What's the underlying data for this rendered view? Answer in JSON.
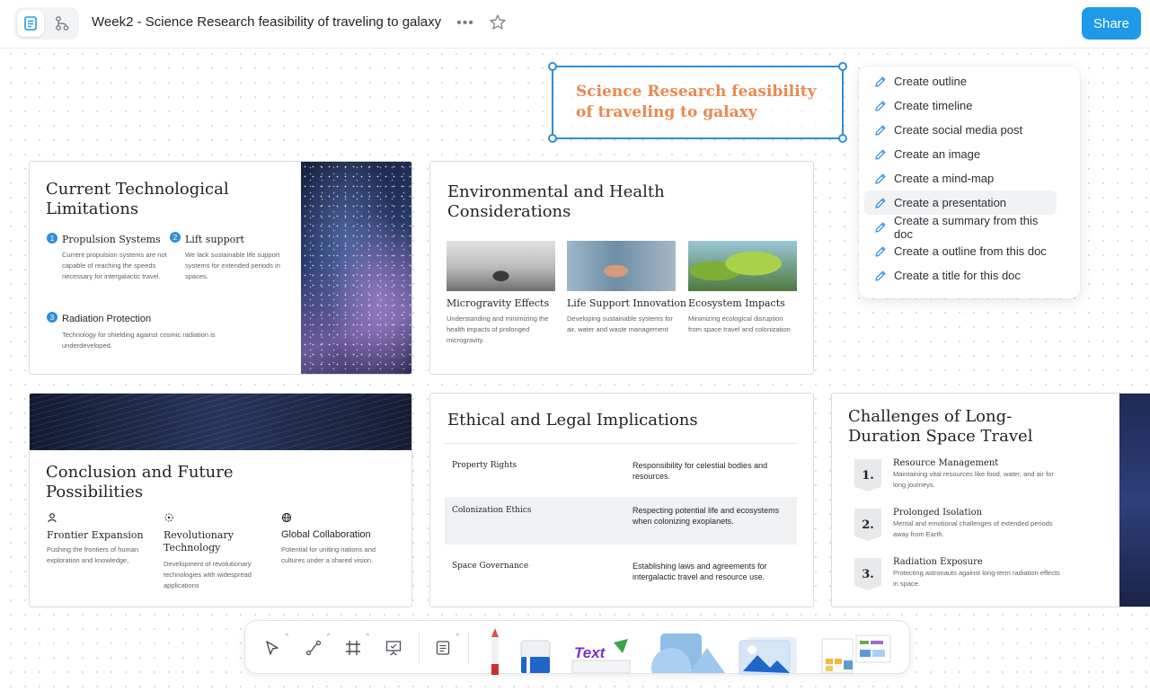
{
  "header": {
    "doc_title": "Week2 -  Science Research feasibility of traveling to galaxy",
    "share_label": "Share",
    "more_label": "•••"
  },
  "selected_text": "Science Research feasibility of traveling to galaxy",
  "ai_menu": {
    "items": [
      "Create outline",
      "Create timeline",
      "Create social media post",
      "Create an image",
      "Create a mind-map",
      "Create a presentation",
      "Create a summary from this doc",
      "Create a outline from this doc",
      "Create a title for this doc"
    ],
    "hovered_index": 5
  },
  "cards": {
    "tech": {
      "title": "Current Technological Limitations",
      "items": [
        {
          "num": "1",
          "heading": "Propulsion Systems",
          "desc": "Current propulsion systems are not capable of reaching the speeds necessary for intergalactic travel."
        },
        {
          "num": "2",
          "heading": "Lift support",
          "desc": "We lack sustainable life support systems for extended periods in spaces."
        },
        {
          "num": "3",
          "heading": "Radiation Protection",
          "desc": "Technology for shielding against cosmic radiation is underdeveloped."
        }
      ]
    },
    "env": {
      "title": "Environmental and Health Considerations",
      "items": [
        {
          "heading": "Microgravity Effects",
          "desc": "Understanding and minimizing the health impacts of prolonged microgravity."
        },
        {
          "heading": "Life Support Innovation",
          "desc": "Developing sustainable systems for air, water and waste management"
        },
        {
          "heading": "Ecosystem Impacts",
          "desc": "Minimizing ecological disruption from space travel and colonization"
        }
      ]
    },
    "conclusion": {
      "title": "Conclusion and Future Possibilities",
      "items": [
        {
          "heading": "Frontier Expansion",
          "desc": "Pushing the frontiers of human exploration and knowledge,"
        },
        {
          "heading": "Revolutionary Technology",
          "desc": "Development of revolutionary technologies with widespread applications"
        },
        {
          "heading": "Global Collaboration",
          "desc": "Potential for uniting nations and cultures under a shared vision."
        }
      ]
    },
    "ethics": {
      "title": "Ethical and Legal Implications",
      "rows": [
        {
          "key": "Property Rights",
          "value": "Responsibility for celestial bodies and resources."
        },
        {
          "key": "Colonization Ethics",
          "value": "Respecting potential life and ecosystems when colonizing exoplanets."
        },
        {
          "key": "Space Governance",
          "value": "Establishing laws and agreements for intergalactic travel and resource use."
        }
      ]
    },
    "challenges": {
      "title": "Challenges of Long-Duration Space Travel",
      "items": [
        {
          "num": "1.",
          "heading": "Resource Management",
          "desc": "Maintaining vital resources like food, water, and air for long journeys."
        },
        {
          "num": "2.",
          "heading": "Prolonged Isolation",
          "desc": "Mental and emotional challenges of extended periods away from Earth."
        },
        {
          "num": "3.",
          "heading": "Radiation Exposure",
          "desc": "Protecting astronauts against long-term radiation effects in space."
        }
      ]
    }
  },
  "toolbar": {
    "tools": [
      "select-tool",
      "connector-tool",
      "frame-tool",
      "presentation-tool",
      "note-tool",
      "pen-tool",
      "eraser-tool",
      "text-tool",
      "shape-tool",
      "image-tool",
      "template-tool"
    ],
    "text_sticker": "Text"
  },
  "colors": {
    "accent": "#1e9ae8",
    "selection": "#2f8fd8",
    "title_orange": "#e9894f"
  }
}
